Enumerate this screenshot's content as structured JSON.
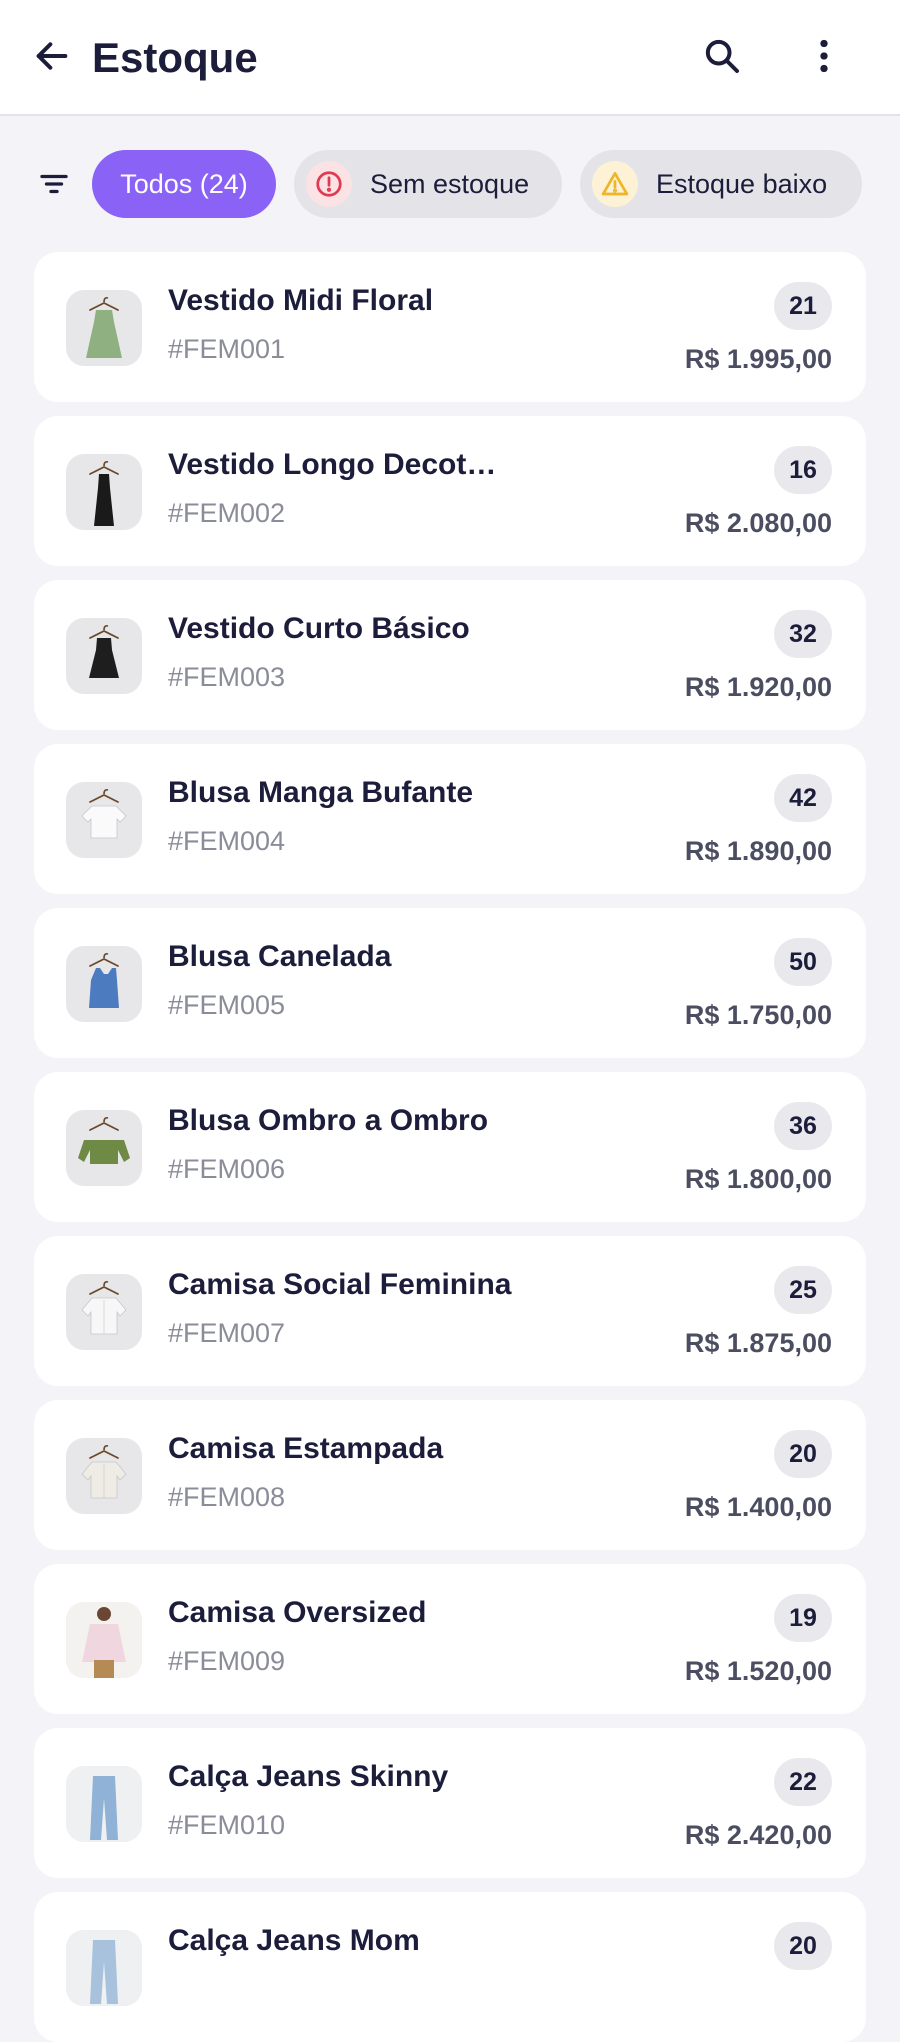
{
  "header": {
    "title": "Estoque",
    "back_icon": "arrow-left-icon",
    "search_icon": "search-icon",
    "more_icon": "more-vertical-icon"
  },
  "filters": {
    "filter_icon": "filter-lines-icon",
    "all_label": "Todos (24)",
    "out_label": "Sem estoque",
    "low_label": "Estoque baixo",
    "accent": "#8a62f6",
    "out_icon_color": "#e3394f",
    "low_icon_color": "#f0b429"
  },
  "products": [
    {
      "name": "Vestido Midi Floral",
      "code": "#FEM001",
      "qty": "21",
      "price": "R$ 1.995,00",
      "color": "#8fb081",
      "shape": "dress-long"
    },
    {
      "name": "Vestido Longo Decot…",
      "code": "#FEM002",
      "qty": "16",
      "price": "R$ 2.080,00",
      "color": "#1a1a1a",
      "shape": "dress-maxi"
    },
    {
      "name": "Vestido Curto Básico",
      "code": "#FEM003",
      "qty": "32",
      "price": "R$ 1.920,00",
      "color": "#1e1e1e",
      "shape": "dress-short"
    },
    {
      "name": "Blusa Manga Bufante",
      "code": "#FEM004",
      "qty": "42",
      "price": "R$ 1.890,00",
      "color": "#fafafa",
      "shape": "blouse"
    },
    {
      "name": "Blusa Canelada",
      "code": "#FEM005",
      "qty": "50",
      "price": "R$ 1.750,00",
      "color": "#4d7bbf",
      "shape": "tank"
    },
    {
      "name": "Blusa Ombro a Ombro",
      "code": "#FEM006",
      "qty": "36",
      "price": "R$ 1.800,00",
      "color": "#6f8a45",
      "shape": "offshoulder"
    },
    {
      "name": "Camisa Social Feminina",
      "code": "#FEM007",
      "qty": "25",
      "price": "R$ 1.875,00",
      "color": "#f7f7f7",
      "shape": "shirt"
    },
    {
      "name": "Camisa Estampada",
      "code": "#FEM008",
      "qty": "20",
      "price": "R$ 1.400,00",
      "color": "#efece6",
      "shape": "shirt"
    },
    {
      "name": "Camisa Oversized",
      "code": "#FEM009",
      "qty": "19",
      "price": "R$ 1.520,00",
      "color": "#f0d6de",
      "shape": "model"
    },
    {
      "name": "Calça Jeans Skinny",
      "code": "#FEM010",
      "qty": "22",
      "price": "R$ 2.420,00",
      "color": "#8fb2d6",
      "shape": "jeans"
    },
    {
      "name": "Calça Jeans Mom",
      "code": "",
      "qty": "20",
      "price": "",
      "color": "#a8c1dc",
      "shape": "jeans"
    }
  ]
}
